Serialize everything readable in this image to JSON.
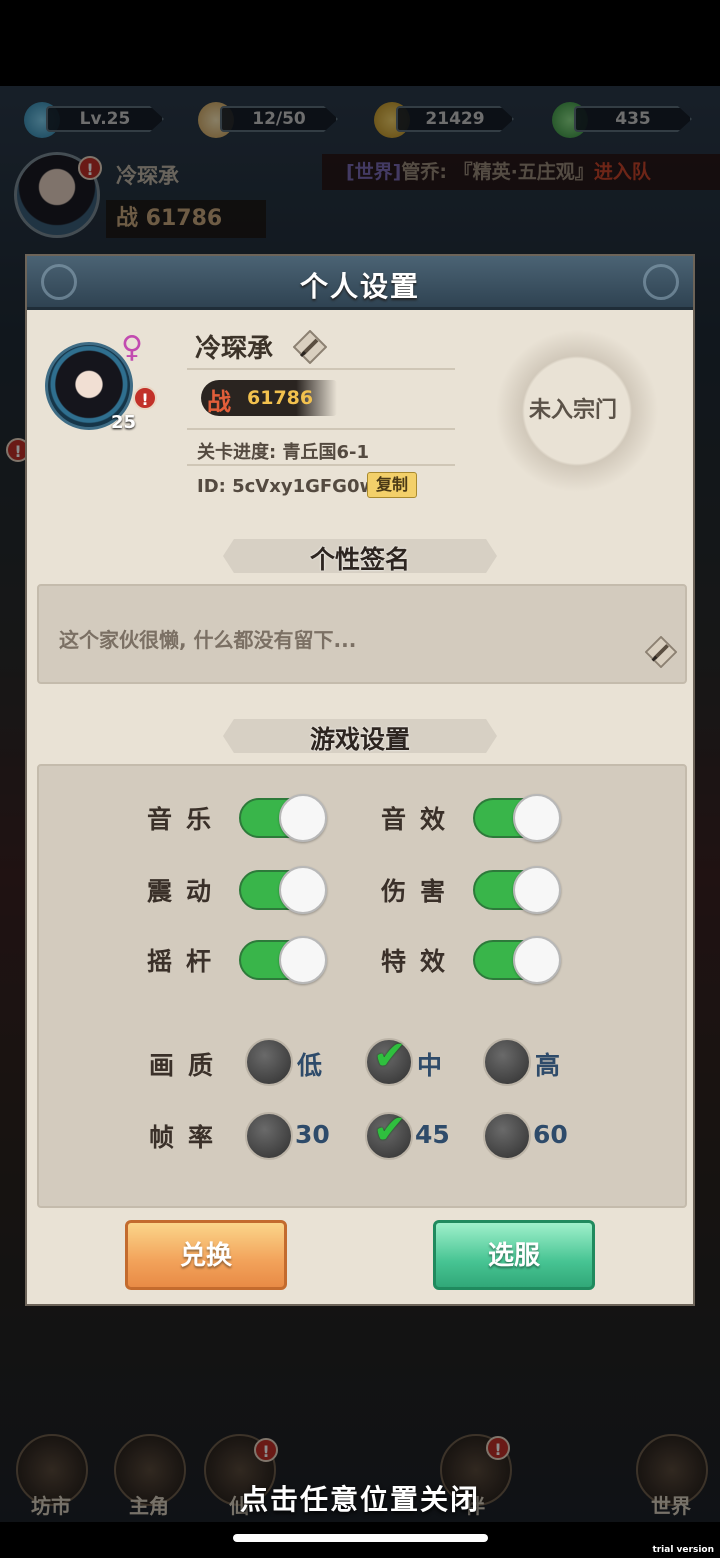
{
  "topbar": {
    "level": "Lv.25",
    "stamina": "12/50",
    "coins": "21429",
    "jade": "435"
  },
  "header": {
    "player_name": "冷琛承",
    "power": "战 61786",
    "chat_channel": "[世界]",
    "chat_text": "管乔: 『精英·五庄观』",
    "chat_join": "进入队",
    "badge": "!"
  },
  "dialog": {
    "title": "个人设置",
    "profile": {
      "name": "冷琛承",
      "gender_symbol": "♀",
      "level": "25",
      "power_label": "战",
      "power_value": "61786",
      "progress": "关卡进度: 青丘国6-1",
      "id": "ID: 5cVxy1GFG0w",
      "copy_label": "复制",
      "sect": "未入宗门"
    },
    "signature": {
      "header": "个性签名",
      "text": "这个家伙很懒, 什么都没有留下..."
    },
    "settings": {
      "header": "游戏设置",
      "toggles": [
        {
          "label": "音乐",
          "on": true
        },
        {
          "label": "音效",
          "on": true
        },
        {
          "label": "震动",
          "on": true
        },
        {
          "label": "伤害",
          "on": true
        },
        {
          "label": "摇杆",
          "on": true
        },
        {
          "label": "特效",
          "on": true
        }
      ],
      "quality": {
        "label": "画质",
        "options": [
          "低",
          "中",
          "高"
        ],
        "selected": "中"
      },
      "framerate": {
        "label": "帧率",
        "options": [
          "30",
          "45",
          "60"
        ],
        "selected": "45"
      }
    },
    "buttons": {
      "exchange": "兑换",
      "server": "选服"
    }
  },
  "bottom_nav": [
    "坊市",
    "主角",
    "仙",
    "伴",
    "世界"
  ],
  "close_hint": "点击任意位置关闭",
  "watermark": "trial version",
  "colors": {
    "toggle_on": "#39b54a",
    "check": "#2fbf3e",
    "title_bar": "#3b5262"
  }
}
